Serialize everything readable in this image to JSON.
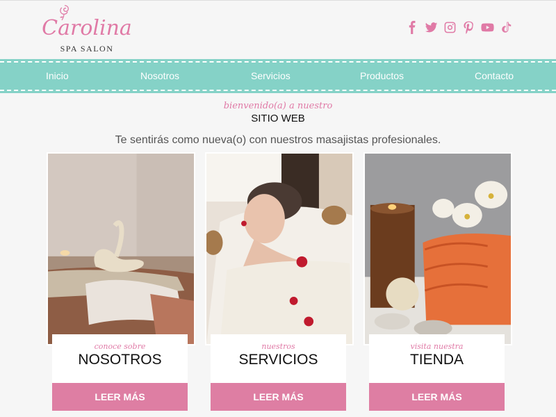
{
  "logo": {
    "name": "Carolina",
    "subtitle": "SPA SALON"
  },
  "social": [
    "facebook-icon",
    "twitter-icon",
    "instagram-icon",
    "pinterest-icon",
    "youtube-icon",
    "tiktok-icon"
  ],
  "nav": {
    "items": [
      "Inicio",
      "Nosotros",
      "Servicios",
      "Productos",
      "Contacto"
    ]
  },
  "intro": {
    "script": "bienvenido(a) a nuestro",
    "title": "SITIO WEB",
    "tagline": "Te sentirás como nueva(o) con nuestros masajistas profesionales."
  },
  "cards": [
    {
      "kicker": "conoce sobre",
      "title": "NOSOTROS",
      "button": "LEER MÁS"
    },
    {
      "kicker": "nuestros",
      "title": "SERVICIOS",
      "button": "LEER MÁS"
    },
    {
      "kicker": "visita nuestra",
      "title": "TIENDA",
      "button": "LEER MÁS"
    }
  ],
  "colors": {
    "accent": "#e07aa6",
    "nav": "#85d2c7",
    "button": "#de7ea3"
  }
}
